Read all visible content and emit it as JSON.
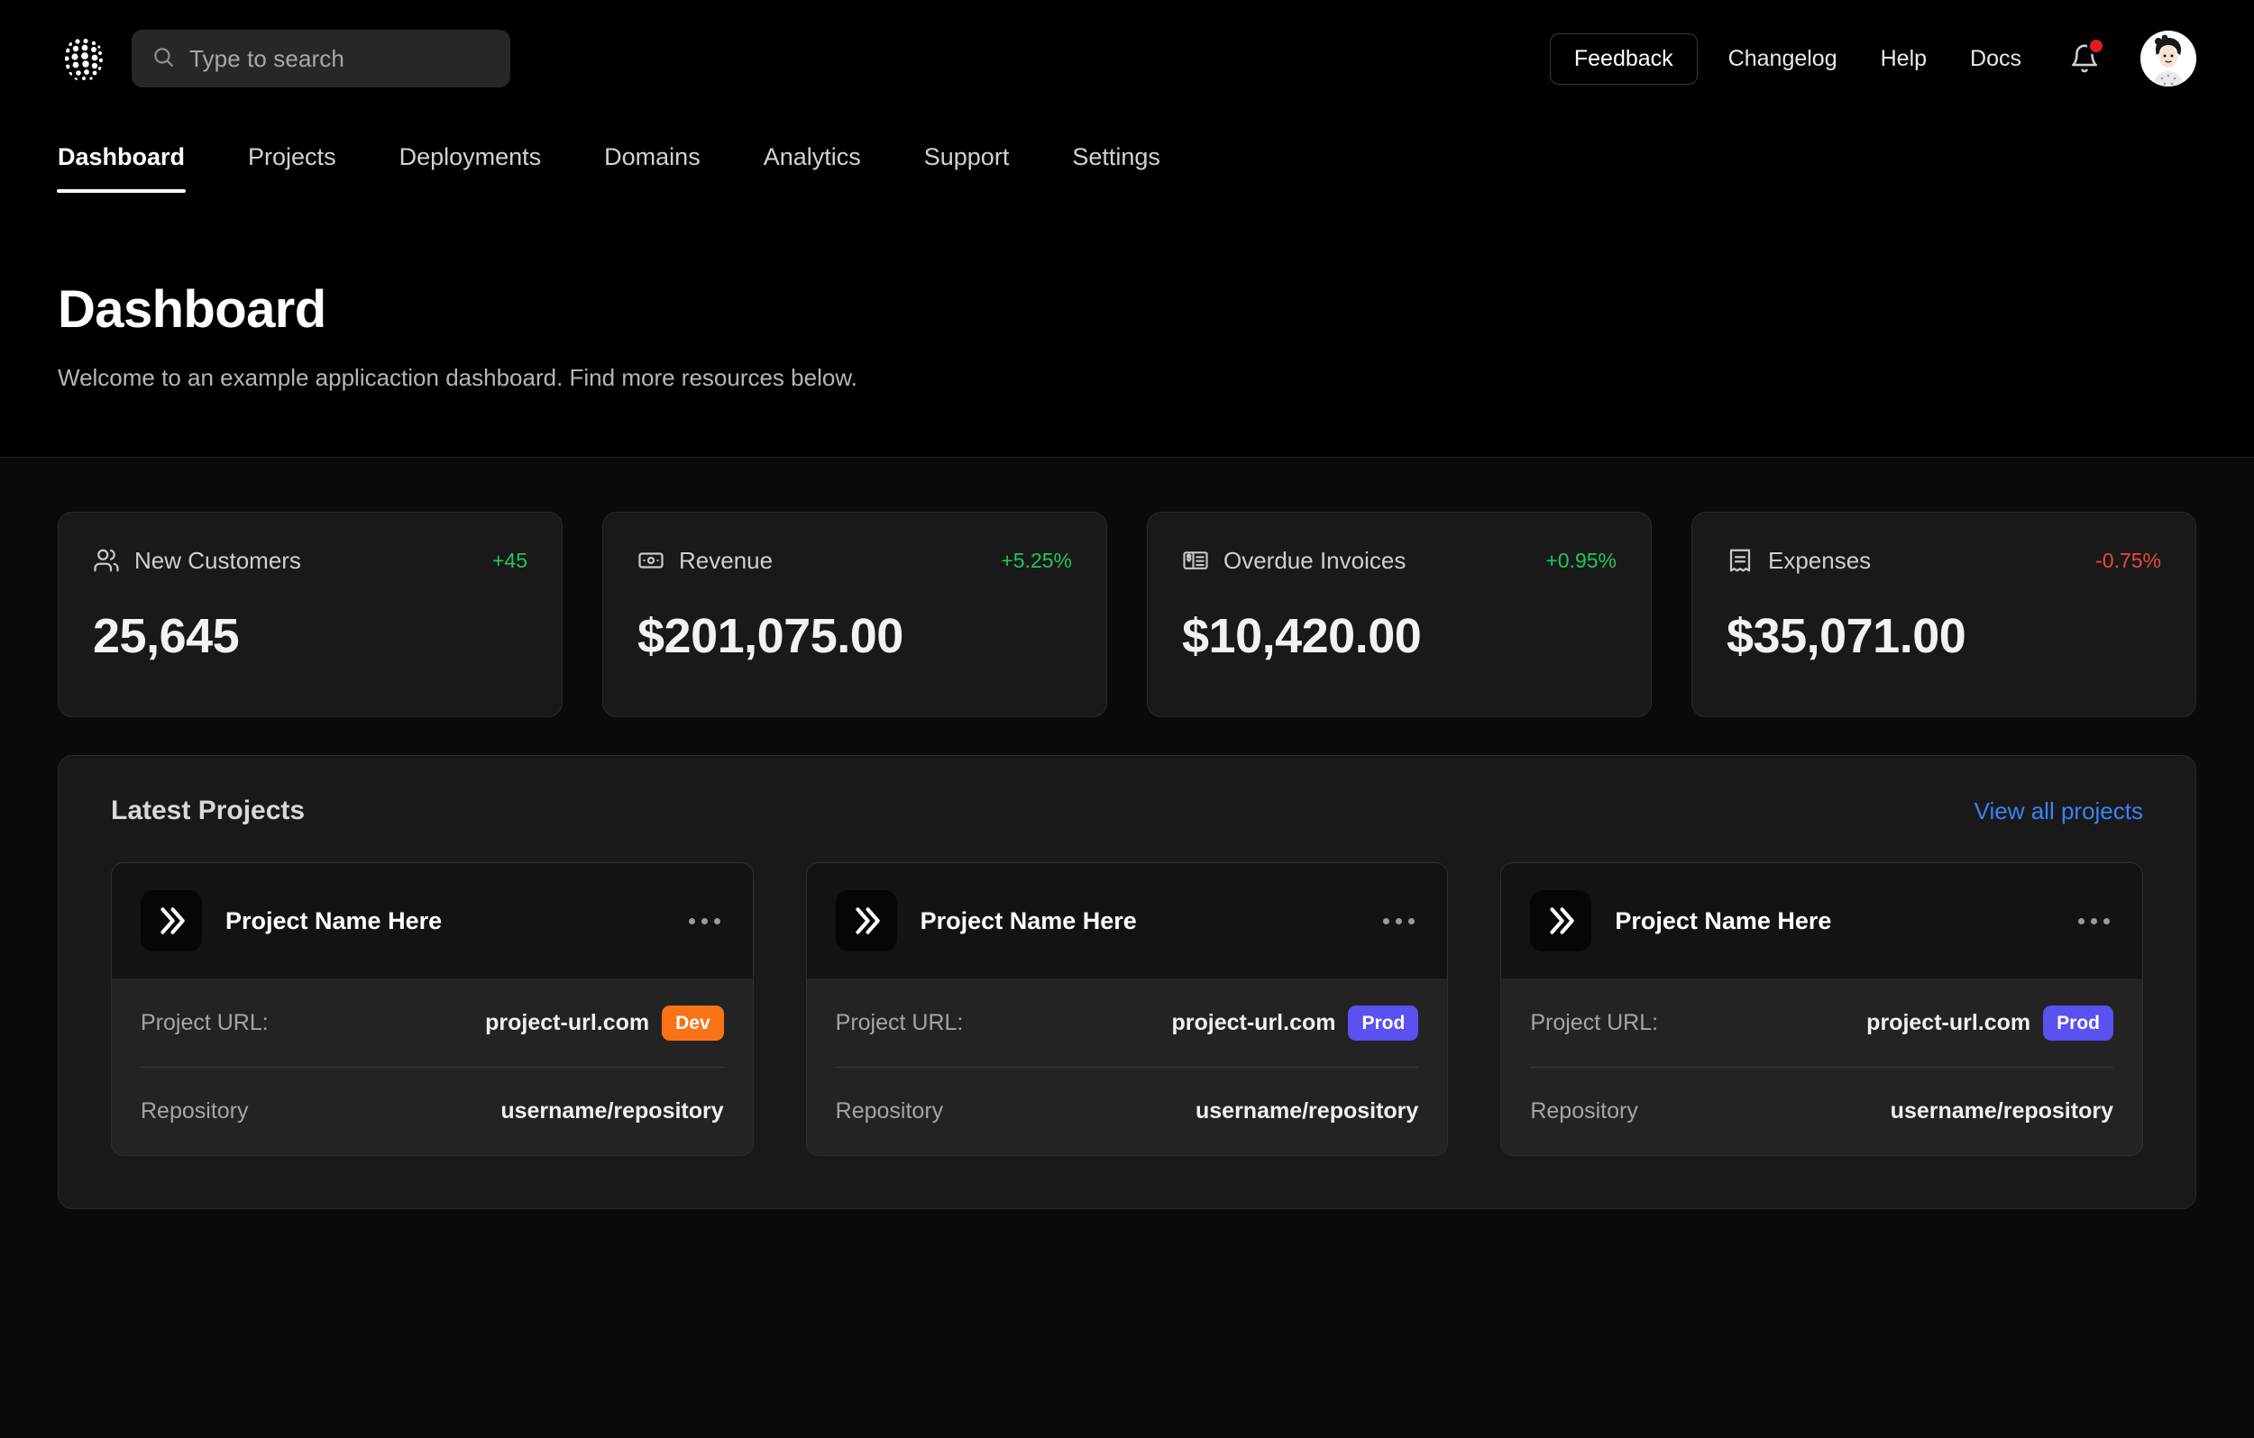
{
  "header": {
    "logo_icon": "halftone-sphere-logo",
    "search": {
      "placeholder": "Type to search",
      "value": "",
      "icon": "search-icon"
    },
    "feedback_label": "Feedback",
    "links": [
      {
        "label": "Changelog"
      },
      {
        "label": "Help"
      },
      {
        "label": "Docs"
      }
    ],
    "notifications": {
      "icon": "bell-icon",
      "has_unread": true,
      "dot_color": "#e01b24"
    },
    "avatar": {
      "icon": "avatar",
      "alt": "User avatar"
    }
  },
  "tabs": [
    {
      "label": "Dashboard",
      "active": true
    },
    {
      "label": "Projects",
      "active": false
    },
    {
      "label": "Deployments",
      "active": false
    },
    {
      "label": "Domains",
      "active": false
    },
    {
      "label": "Analytics",
      "active": false
    },
    {
      "label": "Support",
      "active": false
    },
    {
      "label": "Settings",
      "active": false
    }
  ],
  "page": {
    "title": "Dashboard",
    "subtitle": "Welcome to an example applicaction dashboard. Find more resources below."
  },
  "stats": [
    {
      "label": "New Customers",
      "icon": "users-icon",
      "delta": "+45",
      "delta_dir": "up",
      "value": "25,645"
    },
    {
      "label": "Revenue",
      "icon": "banknote-icon",
      "delta": "+5.25%",
      "delta_dir": "up",
      "value": "$201,075.00"
    },
    {
      "label": "Overdue Invoices",
      "icon": "invoice-icon",
      "delta": "+0.95%",
      "delta_dir": "up",
      "value": "$10,420.00"
    },
    {
      "label": "Expenses",
      "icon": "receipt-icon",
      "delta": "-0.75%",
      "delta_dir": "down",
      "value": "$35,071.00"
    }
  ],
  "latest_projects": {
    "title": "Latest Projects",
    "view_all_label": "View all projects",
    "url_key": "Project URL:",
    "repo_key": "Repository",
    "more_icon": "ellipsis-icon",
    "project_icon": "chevrons-right-icon",
    "cards": [
      {
        "name": "Project Name Here",
        "url": "project-url.com",
        "badge": "Dev",
        "badge_type": "dev",
        "repo": "username/repository"
      },
      {
        "name": "Project Name Here",
        "url": "project-url.com",
        "badge": "Prod",
        "badge_type": "prod",
        "repo": "username/repository"
      },
      {
        "name": "Project Name Here",
        "url": "project-url.com",
        "badge": "Prod",
        "badge_type": "prod",
        "repo": "username/repository"
      }
    ]
  },
  "colors": {
    "background": "#0a0a0a",
    "header_background": "#000000",
    "card_background": "#191919",
    "accent_link": "#3b82f6",
    "positive": "#22c55e",
    "negative": "#ef4444",
    "badge_dev": "#f97316",
    "badge_prod": "#5b50f0"
  }
}
